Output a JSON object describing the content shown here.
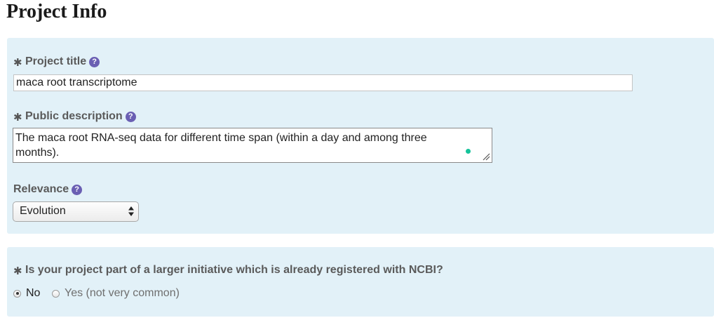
{
  "page": {
    "title": "Project Info"
  },
  "project_title": {
    "label": "Project title",
    "required": true,
    "value": "maca root transcriptome"
  },
  "public_description": {
    "label": "Public description",
    "required": true,
    "value": "The maca root RNA-seq data for different time span (within a day and among three months)."
  },
  "relevance": {
    "label": "Relevance",
    "selected": "Evolution"
  },
  "initiative": {
    "question": "Is your project part of a larger initiative which is already registered with NCBI?",
    "required": true,
    "options": [
      {
        "label": "No",
        "checked": true
      },
      {
        "label": "Yes (not very common)",
        "checked": false
      }
    ]
  },
  "icons": {
    "required": "asterisk-icon",
    "help": "question-circle-icon",
    "select": "up-down-arrows-icon",
    "resize": "resize-grip-icon",
    "grammar": "grammar-check-dot-icon"
  },
  "colors": {
    "panel_bg": "#e2f1f8",
    "help_icon": "#6a5fb3",
    "grammar_dot": "#15c39a"
  }
}
